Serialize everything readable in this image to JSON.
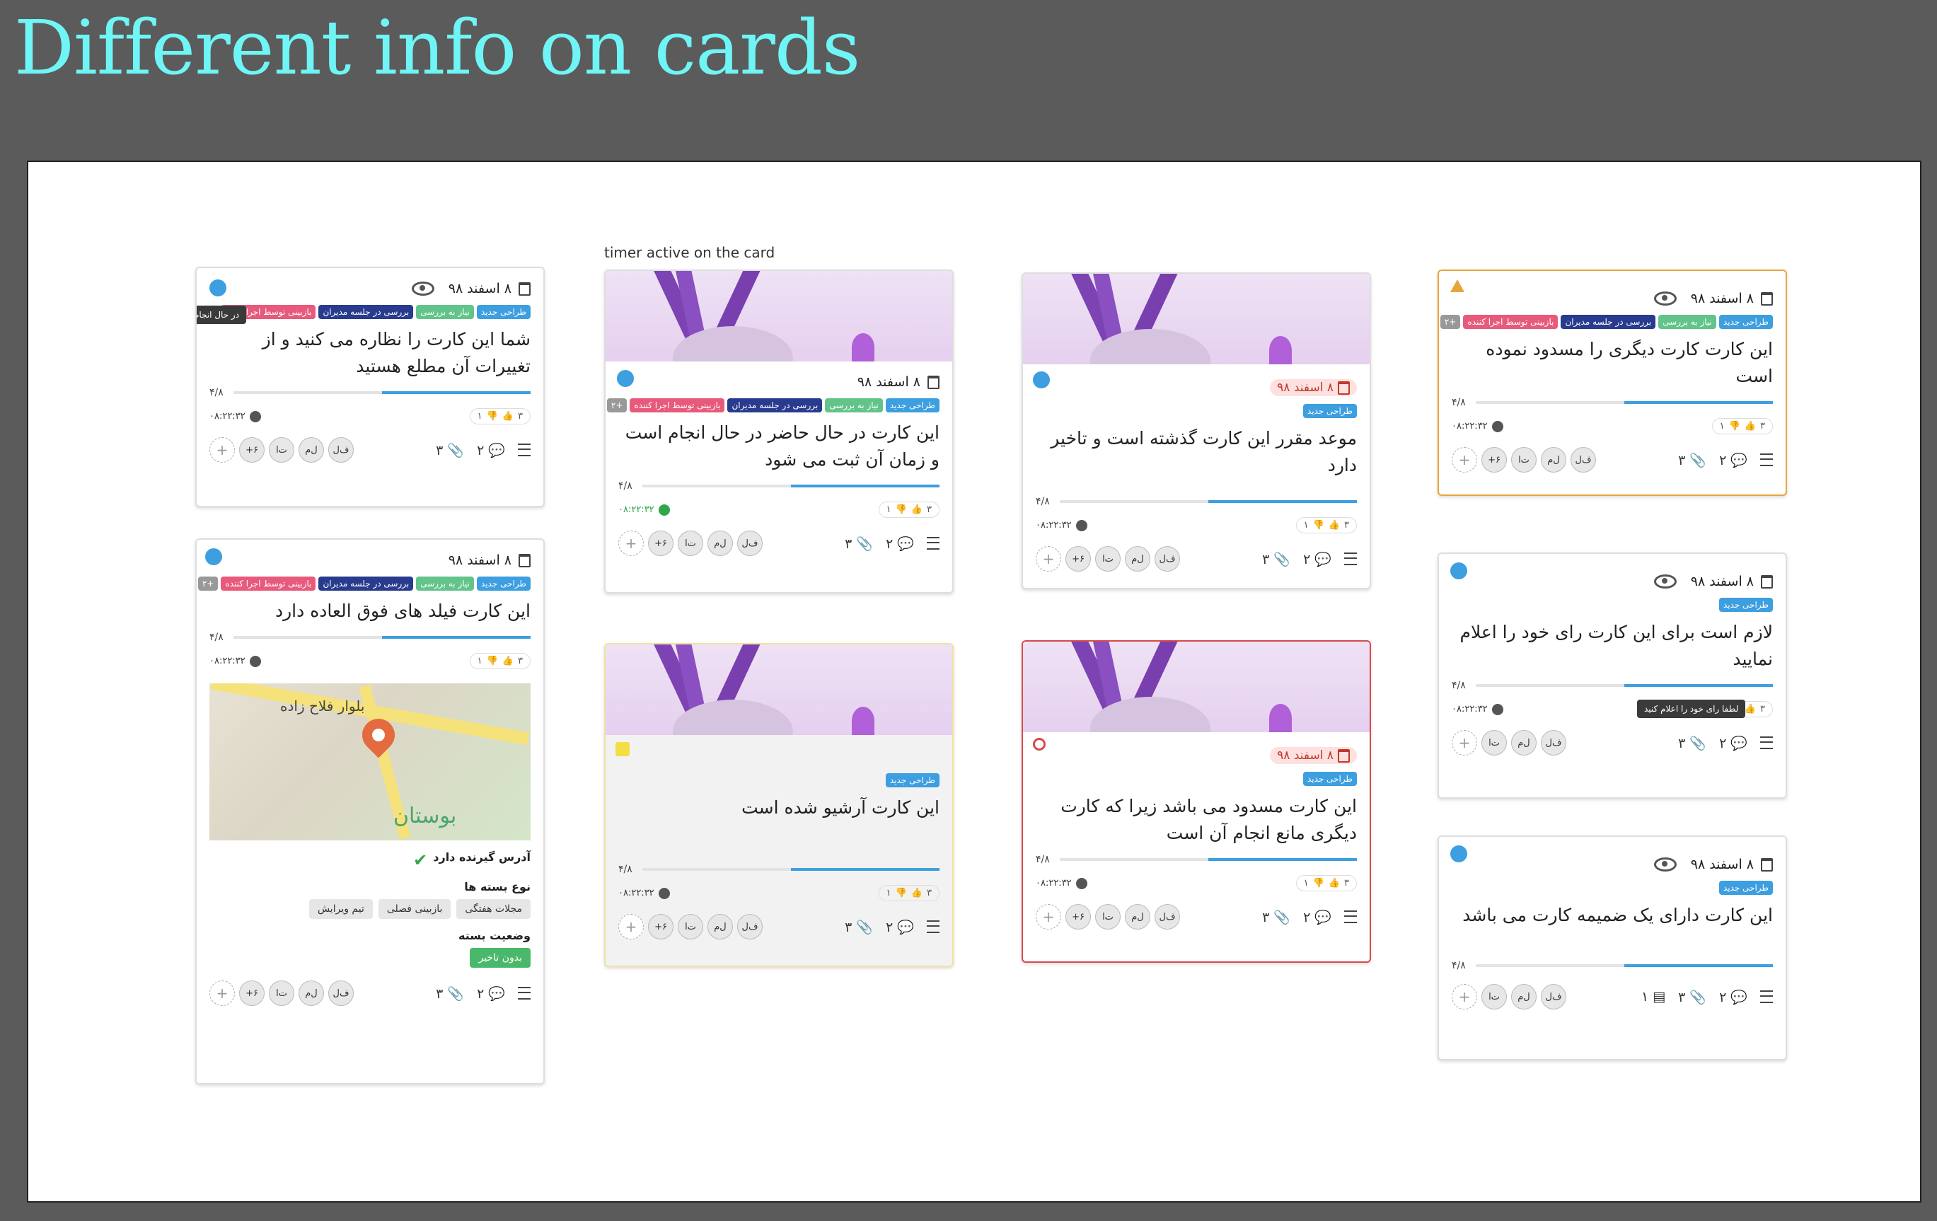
{
  "page_title": "Different info on cards",
  "caption_timer": "timer active on the card",
  "common": {
    "date": "۸ اسفند ۹۸",
    "progress": "۴/۸",
    "timer": "۰۸:۲۲:۳۲",
    "votes_up": "۳",
    "votes_down": "۱",
    "comments": "۲",
    "attachments": "۳",
    "add": "+",
    "avatars": [
      "ف‌ل",
      "ل‌م",
      "ت‌ا",
      "+۶"
    ]
  },
  "tags": {
    "design": "طراحی جدید",
    "review": "نیاز به بررسی",
    "meeting": "بررسی در جلسه مدیران",
    "rework": "بازبینی توسط اجرا کننده",
    "count": "+۲"
  },
  "cards": {
    "watching": {
      "title": "شما این کارت را نظاره می کنید و از تغییرات آن مطلع هستید",
      "tooltip": "در حال انجام",
      "progress_pct": 0.5
    },
    "timer": {
      "title": "این کارت در حال حاضر در حال انجام است و زمان آن ثبت می شود",
      "progress_pct": 0.5
    },
    "overdue": {
      "title": "موعد مقرر این کارت گذشته است و تاخیر دارد",
      "progress_pct": 0.5
    },
    "blocking": {
      "title": "این کارت کارت دیگری را مسدود نموده است",
      "progress_pct": 0.5
    },
    "fields": {
      "title": "این کارت فیلد های فوق العاده دارد",
      "progress_pct": 0.5,
      "map_labels": [
        "بلوار فلاح زاده",
        "بوستان"
      ],
      "has_address": "آدرس گیرنده دارد",
      "package_type_label": "نوع بسته ها",
      "package_types": [
        "مجلات هفتگی",
        "بازبینی فصلی",
        "تیم ویرایش"
      ],
      "status_label": "وضعیت بسته",
      "status_value": "بدون تاخیر"
    },
    "archived": {
      "title": "این کارت آرشیو شده است",
      "progress_pct": 0.5
    },
    "blocked": {
      "title": "این کارت مسدود می باشد زیرا که کارت دیگری مانع انجام آن است",
      "progress_pct": 0.5
    },
    "vote": {
      "title": "لازم است برای این کارت رای خود را اعلام نمایید",
      "tooltip": "لطفا رای خود را اعلام کنید",
      "progress_pct": 0.5
    },
    "attachment": {
      "title": "این کارت دارای یک ضمیمه کارت می باشد",
      "progress_pct": 0.5,
      "card_attach": "۱"
    }
  },
  "colors": {
    "accent": "#3d9ee0",
    "title": "#6ff5f5",
    "red": "#d84a4a",
    "orange": "#e8a53c"
  }
}
